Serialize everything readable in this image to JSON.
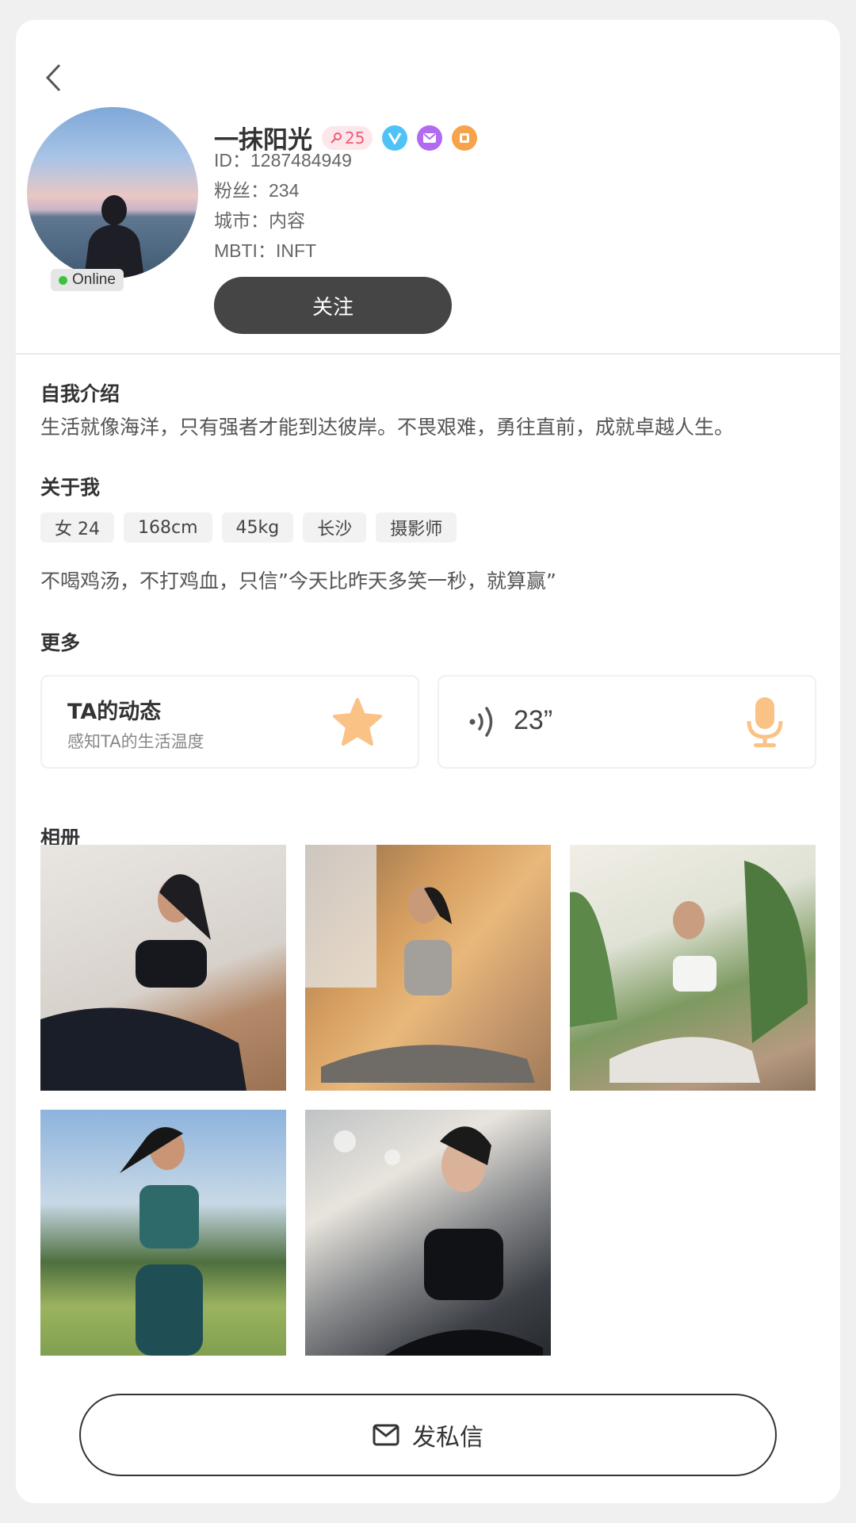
{
  "profile": {
    "name": "一抹阳光",
    "level": "25",
    "online_label": "Online",
    "id_line": "ID：1287484949",
    "fans_line": "粉丝：234",
    "city_line": "城市：内容",
    "mbti_line": "MBTI：INFT",
    "follow_label": "关注",
    "badges": [
      {
        "icon": "v-verified-icon",
        "color": "#4fc3f7"
      },
      {
        "icon": "mail-badge-icon",
        "color": "#b26bf0"
      },
      {
        "icon": "square-badge-icon",
        "color": "#f7a34b"
      }
    ]
  },
  "intro": {
    "title": "自我介绍",
    "text": "生活就像海洋，只有强者才能到达彼岸。不畏艰难，勇往直前，成就卓越人生。"
  },
  "about": {
    "title": "关于我",
    "tags": [
      "女 24",
      "168cm",
      "45kg",
      "长沙",
      "摄影师"
    ],
    "motto": "不喝鸡汤，不打鸡血，只信”今天比昨天多笑一秒，就算赢”"
  },
  "more": {
    "title": "更多",
    "moments_title": "TA的动态",
    "moments_sub": "感知TA的生活温度",
    "voice_duration": "23”"
  },
  "album": {
    "title": "相册",
    "photos": [
      "photo-1",
      "photo-2",
      "photo-3",
      "photo-4",
      "photo-5"
    ]
  },
  "message_label": "发私信",
  "colors": {
    "follow_bg": "#454545",
    "level_bg": "#fde7ea",
    "level_text": "#ee5d78",
    "online_dot": "#3bc43b",
    "star": "#fbc286"
  }
}
